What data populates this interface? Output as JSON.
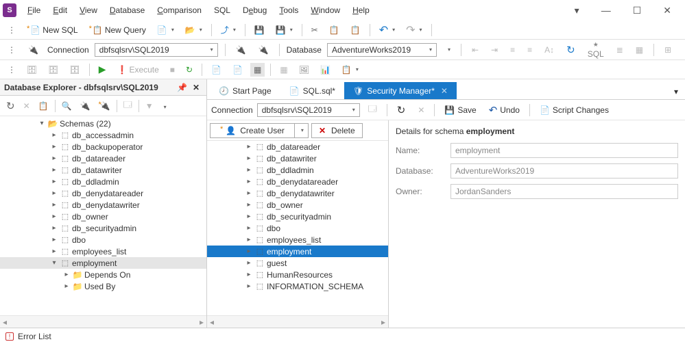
{
  "menu": [
    "File",
    "Edit",
    "View",
    "Database",
    "Comparison",
    "SQL",
    "Debug",
    "Tools",
    "Window",
    "Help"
  ],
  "toolbar": {
    "new_sql": "New SQL",
    "new_query": "New Query"
  },
  "connection": {
    "label": "Connection",
    "value": "dbfsqlsrv\\SQL2019",
    "db_label": "Database",
    "db_value": "AdventureWorks2019"
  },
  "explorer": {
    "title": "Database Explorer - dbfsqlsrv\\SQL2019",
    "schemas_label": "Schemas (22)",
    "items": [
      "db_accessadmin",
      "db_backupoperator",
      "db_datareader",
      "db_datawriter",
      "db_ddladmin",
      "db_denydatareader",
      "db_denydatawriter",
      "db_owner",
      "db_securityadmin",
      "dbo",
      "employees_list",
      "employment"
    ],
    "sub": [
      "Depends On",
      "Used By"
    ]
  },
  "tabs": {
    "start": "Start Page",
    "sql": "SQL.sql*",
    "security": "Security Manager*"
  },
  "doc_toolbar": {
    "conn_label": "Connection",
    "conn_value": "dbfsqlsrv\\SQL2019",
    "save": "Save",
    "undo": "Undo",
    "script": "Script Changes"
  },
  "mid": {
    "create_user": "Create User",
    "delete": "Delete",
    "items": [
      "db_datareader",
      "db_datawriter",
      "db_ddladmin",
      "db_denydatareader",
      "db_denydatawriter",
      "db_owner",
      "db_securityadmin",
      "dbo",
      "employees_list",
      "employment",
      "guest",
      "HumanResources",
      "INFORMATION_SCHEMA"
    ],
    "selected": "employment"
  },
  "details": {
    "heading_prefix": "Details for schema ",
    "heading_schema": "employment",
    "name_label": "Name:",
    "name_value": "employment",
    "db_label": "Database:",
    "db_value": "AdventureWorks2019",
    "owner_label": "Owner:",
    "owner_value": "JordanSanders"
  },
  "status": {
    "error_list": "Error List"
  },
  "execute_label": "Execute",
  "sql_tag": "SQL"
}
